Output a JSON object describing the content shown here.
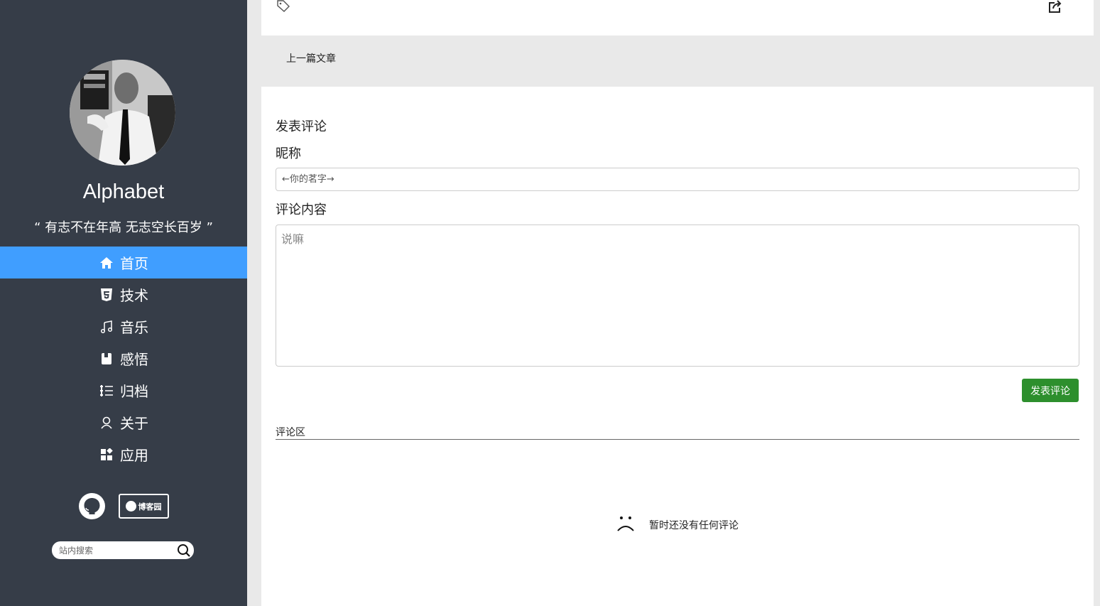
{
  "sidebar": {
    "site_name": "Alphabet",
    "motto": "“ 有志不在年高 无志空长百岁 ”",
    "nav": [
      {
        "label": "首页",
        "icon": "home-icon",
        "active": true
      },
      {
        "label": "技术",
        "icon": "html5-icon",
        "active": false
      },
      {
        "label": "音乐",
        "icon": "music-icon",
        "active": false
      },
      {
        "label": "感悟",
        "icon": "book-icon",
        "active": false
      },
      {
        "label": "归档",
        "icon": "list-icon",
        "active": false
      },
      {
        "label": "关于",
        "icon": "user-icon",
        "active": false
      },
      {
        "label": "应用",
        "icon": "apps-icon",
        "active": false
      }
    ],
    "social": {
      "github_icon": "github-icon",
      "cnblogs_label": "博客园"
    },
    "search": {
      "placeholder": "站内搜索",
      "icon": "search-icon"
    }
  },
  "article": {
    "tag_icon": "tag-icon",
    "share_icon": "share-icon",
    "prev_article": "上一篇文章"
  },
  "comment_form": {
    "heading": "发表评论",
    "nickname_label": "昵称",
    "nickname_placeholder": "←你的茗字→",
    "content_label": "评论内容",
    "content_placeholder": "说嘛",
    "submit_label": "发表评论"
  },
  "comments": {
    "title": "评论区",
    "empty_icon": "sad-face-icon",
    "empty_text": "暂时还没有任何评论"
  },
  "colors": {
    "sidebar_bg": "#363d48",
    "active_nav": "#409eff",
    "submit_button": "#2d8f2d",
    "page_bg": "#e9e9e9"
  }
}
